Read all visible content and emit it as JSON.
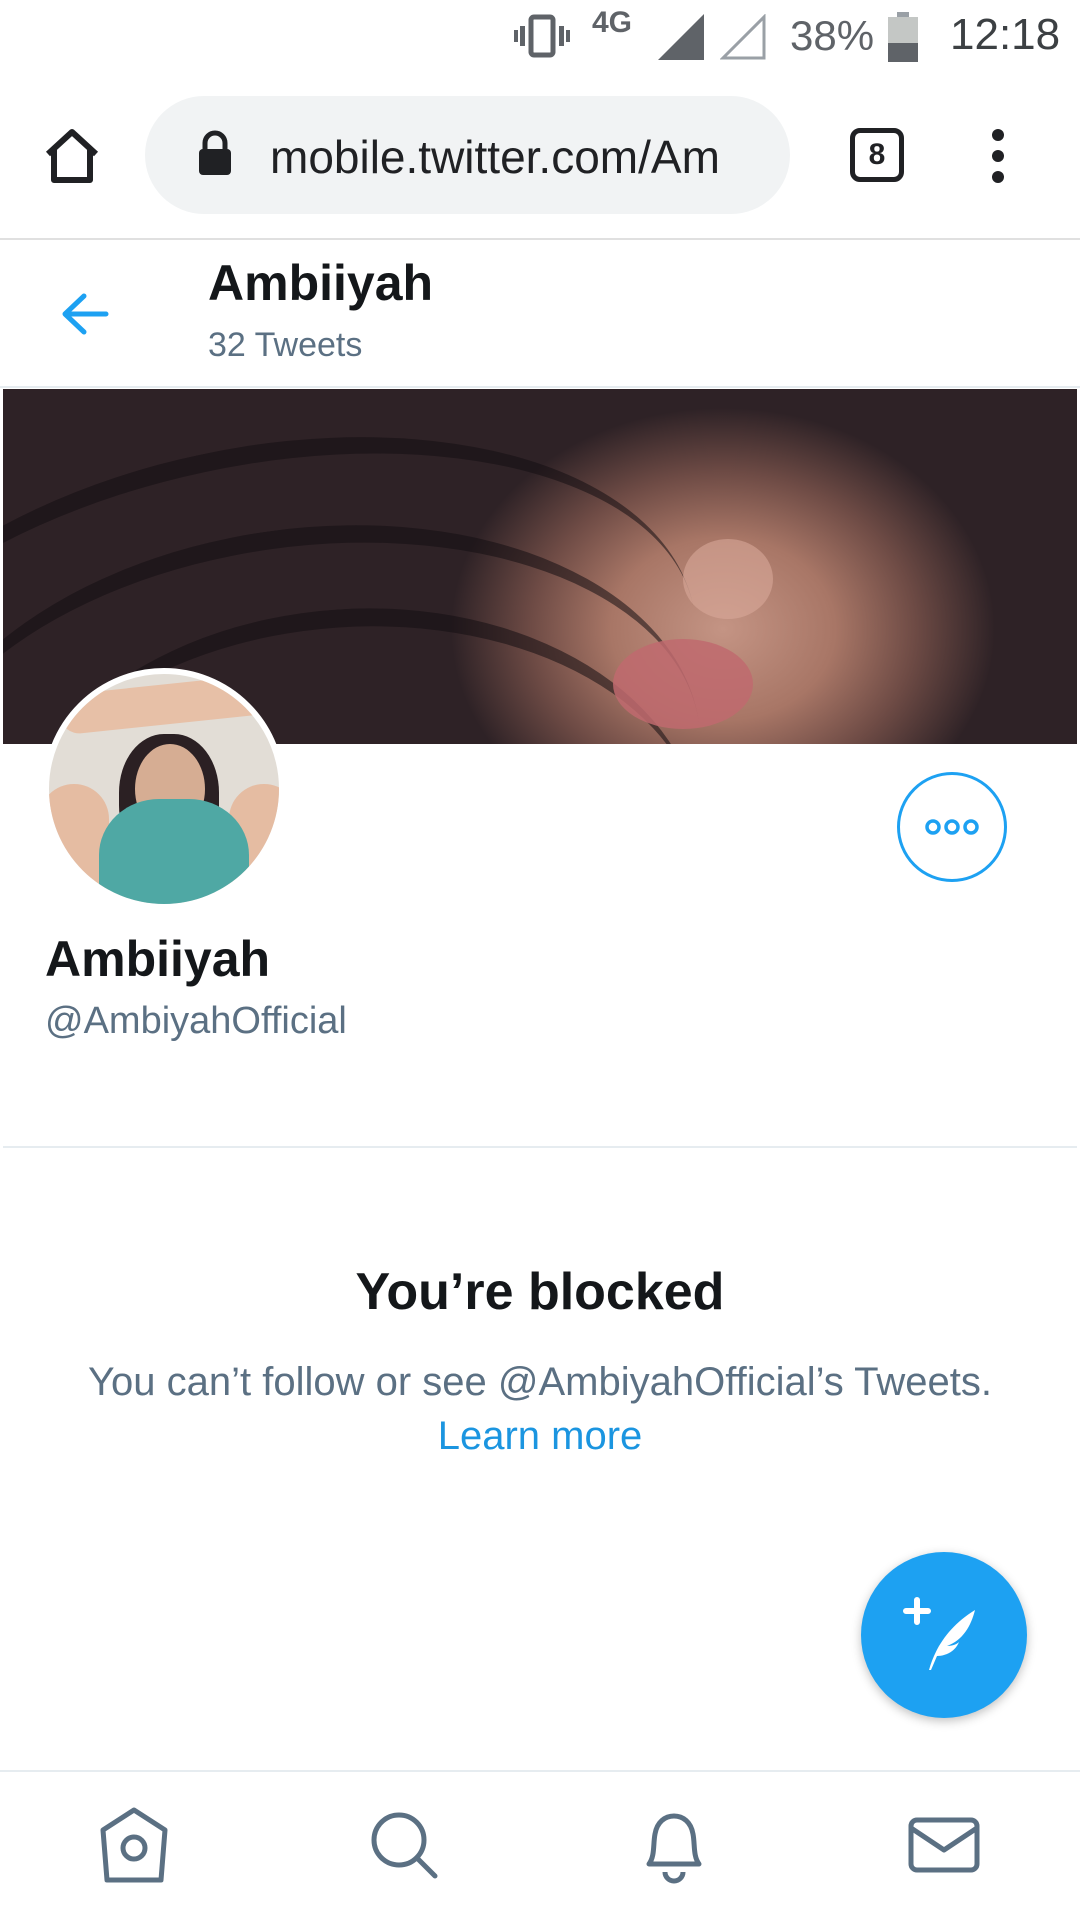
{
  "status_bar": {
    "network": "4G",
    "battery": "38%",
    "time": "12:18"
  },
  "browser": {
    "url": "mobile.twitter.com/Am",
    "tab_count": "8"
  },
  "header": {
    "name": "Ambiiyah",
    "tweet_count": "32 Tweets"
  },
  "profile": {
    "display_name": "Ambiiyah",
    "handle": "@AmbiyahOfficial"
  },
  "blocked": {
    "title": "You’re blocked",
    "message": "You can’t follow or see @AmbiyahOfficial’s Tweets.",
    "learn_more": "Learn more"
  },
  "colors": {
    "accent": "#1da1f2",
    "link": "#1b95e0",
    "secondary_text": "#5b7083"
  },
  "icons": [
    "vibrate-icon",
    "signal-icon",
    "battery-icon",
    "home-icon",
    "lock-icon",
    "tab-switcher-icon",
    "overflow-menu-icon",
    "back-arrow-icon",
    "more-dots-icon",
    "compose-tweet-icon",
    "home-nav-icon",
    "search-icon",
    "notifications-icon",
    "messages-icon"
  ]
}
